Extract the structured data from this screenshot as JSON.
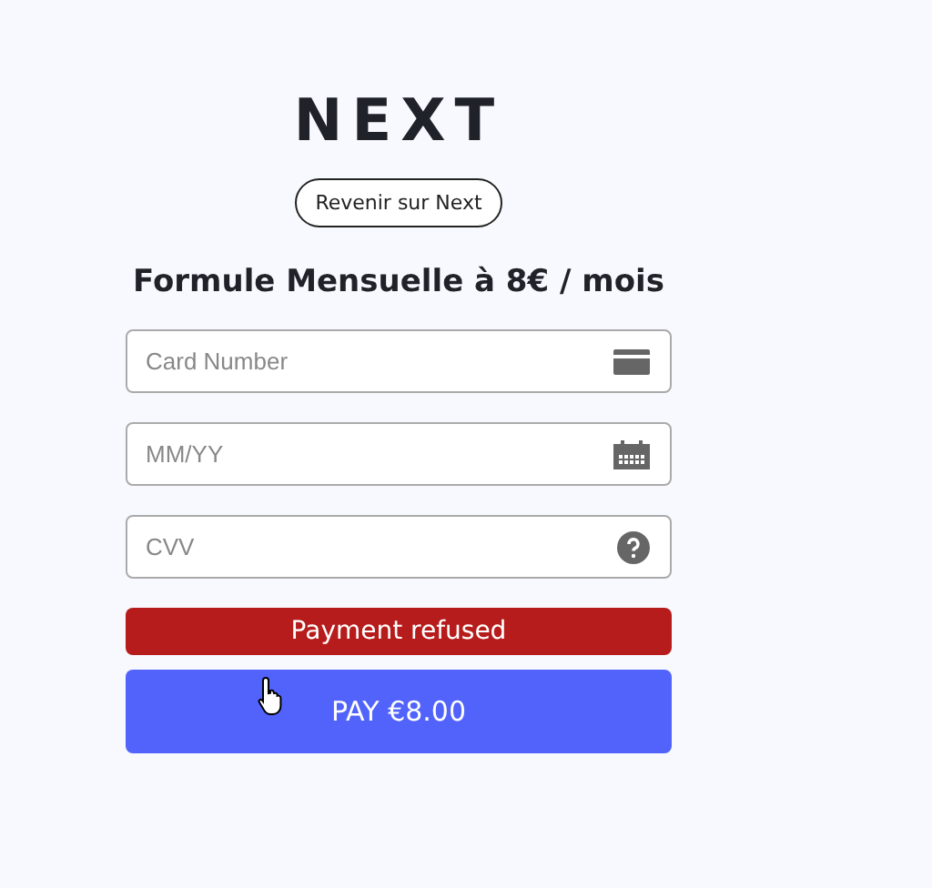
{
  "logo": "NEXT",
  "back_button": "Revenir sur Next",
  "title": "Formule Mensuelle à 8€ / mois",
  "fields": [
    {
      "kind": "card",
      "placeholder": "Card Number"
    },
    {
      "kind": "date",
      "placeholder": "MM/YY"
    },
    {
      "kind": "help",
      "placeholder": "CVV"
    }
  ],
  "error": "Payment refused",
  "pay_button": "PAY €8.00"
}
